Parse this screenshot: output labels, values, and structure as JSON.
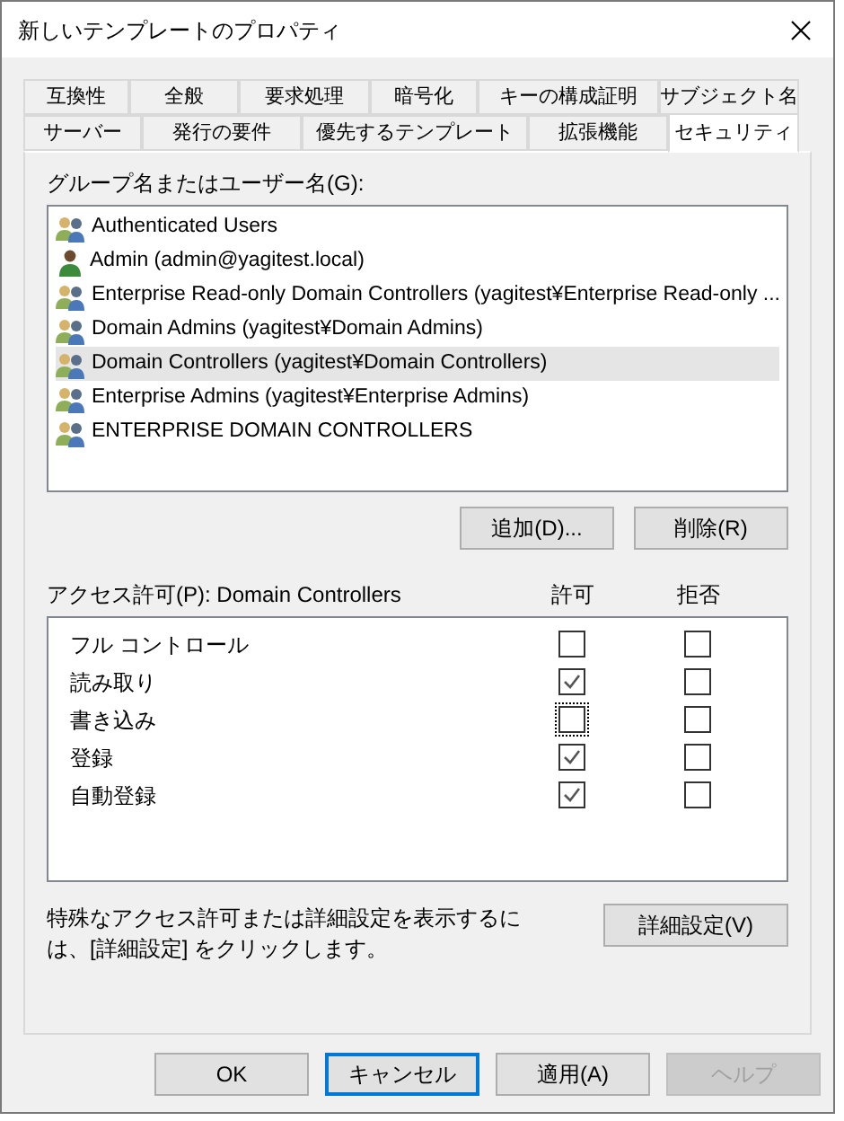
{
  "window": {
    "title": "新しいテンプレートのプロパティ"
  },
  "tab_rows": [
    [
      {
        "label": "互換性",
        "selected": false
      },
      {
        "label": "全般",
        "selected": false
      },
      {
        "label": "要求処理",
        "selected": false
      },
      {
        "label": "暗号化",
        "selected": false
      },
      {
        "label": "キーの構成証明",
        "selected": false
      },
      {
        "label": "サブジェクト名",
        "selected": false
      }
    ],
    [
      {
        "label": "サーバー",
        "selected": false
      },
      {
        "label": "発行の要件",
        "selected": false
      },
      {
        "label": "優先するテンプレート",
        "selected": false
      },
      {
        "label": "拡張機能",
        "selected": false
      },
      {
        "label": "セキュリティ",
        "selected": true
      }
    ]
  ],
  "principals": {
    "label": "グループ名またはユーザー名(G):",
    "items": [
      {
        "name": "Authenticated Users",
        "kind": "group",
        "selected": false
      },
      {
        "name": "Admin (admin@yagitest.local)",
        "kind": "user",
        "selected": false
      },
      {
        "name": "Enterprise Read-only Domain Controllers (yagitest¥Enterprise Read-only ...",
        "kind": "group",
        "selected": false
      },
      {
        "name": "Domain Admins (yagitest¥Domain Admins)",
        "kind": "group",
        "selected": false
      },
      {
        "name": "Domain Controllers (yagitest¥Domain Controllers)",
        "kind": "group",
        "selected": true
      },
      {
        "name": "Enterprise Admins (yagitest¥Enterprise Admins)",
        "kind": "group",
        "selected": false
      },
      {
        "name": "ENTERPRISE DOMAIN CONTROLLERS",
        "kind": "group",
        "selected": false
      }
    ],
    "buttons": [
      "追加(D)...",
      "削除(R)"
    ]
  },
  "permissions": {
    "label": "アクセス許可(P): Domain Controllers",
    "allow_header": "許可",
    "deny_header": "拒否",
    "rows": [
      {
        "name": "フル コントロール",
        "allow": false,
        "deny": false,
        "focused": false
      },
      {
        "name": "読み取り",
        "allow": true,
        "deny": false,
        "focused": false
      },
      {
        "name": "書き込み",
        "allow": false,
        "deny": false,
        "focused": true
      },
      {
        "name": "登録",
        "allow": true,
        "deny": false,
        "focused": false
      },
      {
        "name": "自動登録",
        "allow": true,
        "deny": false,
        "focused": false
      }
    ]
  },
  "advanced": {
    "text": "特殊なアクセス許可または詳細設定を表示するには、[詳細設定] をクリックします。",
    "button": "詳細設定(V)"
  },
  "footer_buttons": [
    {
      "label": "OK",
      "default": false,
      "disabled": false
    },
    {
      "label": "キャンセル",
      "default": true,
      "disabled": false
    },
    {
      "label": "適用(A)",
      "default": false,
      "disabled": false
    },
    {
      "label": "ヘルプ",
      "default": false,
      "disabled": true
    }
  ]
}
